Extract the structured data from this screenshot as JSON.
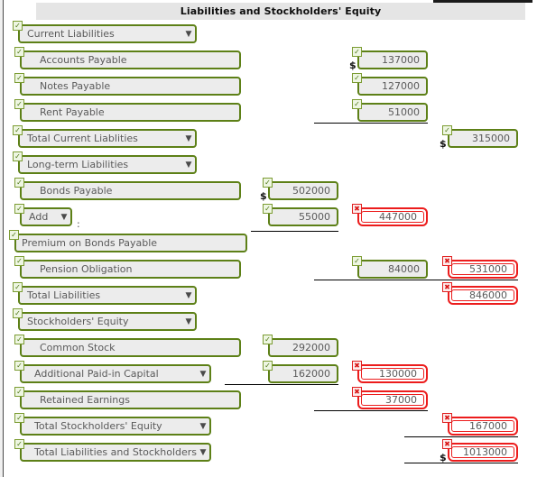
{
  "header": {
    "title": "Liabilities and Stockholders' Equity"
  },
  "icons": {
    "ok": "✓",
    "err": "✖",
    "caret": "▼",
    "dollar": "$"
  },
  "colors": {
    "valid_border": "#5d8017",
    "invalid_border": "#ec1c1c",
    "field_bg": "#ececec",
    "header_bg": "#e5e5e5",
    "text": "#5a5a5a"
  },
  "rows": [
    {
      "label": "Current Liabilities",
      "kind": "select",
      "status": "ok"
    },
    {
      "label": "Accounts Payable",
      "kind": "item",
      "status": "ok",
      "col3": {
        "value": "137000",
        "status": "ok",
        "dollar": "$"
      }
    },
    {
      "label": "Notes Payable",
      "kind": "item",
      "status": "ok",
      "col3": {
        "value": "127000",
        "status": "ok"
      }
    },
    {
      "label": "Rent Payable",
      "kind": "item",
      "status": "ok",
      "col3": {
        "value": "51000",
        "status": "ok",
        "rule": true
      }
    },
    {
      "label": "Total Current Liablities",
      "kind": "select",
      "status": "ok",
      "col4": {
        "value": "315000",
        "status": "ok",
        "dollar": "$"
      }
    },
    {
      "label": "Long-term Liabilities",
      "kind": "select",
      "status": "ok"
    },
    {
      "label": "Bonds Payable",
      "kind": "item",
      "status": "ok",
      "col2": {
        "value": "502000",
        "status": "ok",
        "dollar": "$"
      }
    },
    {
      "label": "Add",
      "kind": "add",
      "status": "ok",
      "suffix": ":",
      "col2": {
        "value": "55000",
        "status": "ok"
      },
      "col3": {
        "value": "447000",
        "status": "err"
      }
    },
    {
      "label": "Premium on Bonds Payable",
      "kind": "flat",
      "status": "ok",
      "rule2": true
    },
    {
      "label": "Pension Obligation",
      "kind": "item",
      "status": "ok",
      "col3": {
        "value": "84000",
        "status": "ok",
        "rule": true
      },
      "col4": {
        "value": "531000",
        "status": "err",
        "rule": true
      }
    },
    {
      "label": "Total Liabilities",
      "kind": "select",
      "status": "ok",
      "col4": {
        "value": "846000",
        "status": "err"
      }
    },
    {
      "label": "Stockholders' Equity",
      "kind": "select",
      "status": "ok"
    },
    {
      "label": "Common Stock",
      "kind": "item",
      "status": "ok",
      "col2": {
        "value": "292000",
        "status": "ok"
      }
    },
    {
      "label": "Additional Paid-in Capital",
      "kind": "select-wide",
      "status": "ok",
      "col2": {
        "value": "162000",
        "status": "ok",
        "rule": true
      },
      "col3": {
        "value": "130000",
        "status": "err"
      }
    },
    {
      "label": "Retained Earnings",
      "kind": "item",
      "status": "ok",
      "col3": {
        "value": "37000",
        "status": "err",
        "rule": true
      }
    },
    {
      "label": "Total Stockholders' Equity",
      "kind": "select-wide",
      "status": "ok",
      "col4": {
        "value": "167000",
        "status": "err",
        "rule": true
      }
    },
    {
      "label": "Total Liabilities and Stockholders' Equity",
      "kind": "select-wide",
      "status": "ok",
      "col4": {
        "value": "1013000",
        "status": "err",
        "dollar": "$",
        "rule": true
      }
    }
  ]
}
